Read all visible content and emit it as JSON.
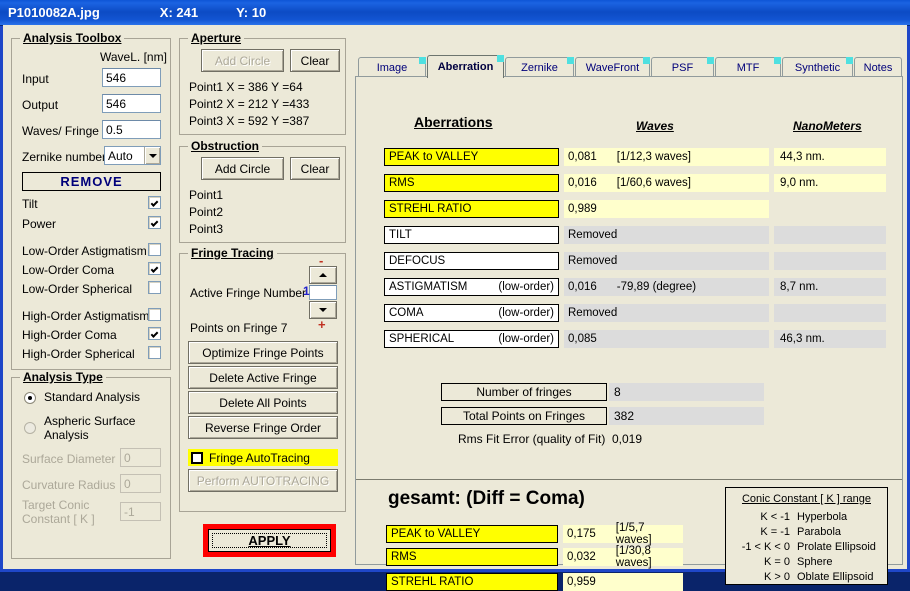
{
  "window": {
    "title": "P1010082A.jpg",
    "cursor_x_label": "X: 241",
    "cursor_y_label": "Y: 10"
  },
  "analysis_toolbox": {
    "legend": "Analysis Toolbox",
    "wavelength_header": "WaveL. [nm]",
    "input_label": "Input",
    "input_value": "546",
    "output_label": "Output",
    "output_value": "546",
    "waves_per_fringe_label": "Waves/ Fringe",
    "waves_per_fringe_value": "0.5",
    "zernike_number_label": "Zernike number",
    "zernike_number_value": "Auto",
    "remove_header": "REMOVE",
    "remove_items": [
      {
        "label": "Tilt",
        "checked": true
      },
      {
        "label": "Power",
        "checked": true
      },
      {
        "label": "Low-Order  Astigmatism",
        "checked": false
      },
      {
        "label": "Low-Order  Coma",
        "checked": true
      },
      {
        "label": "Low-Order  Spherical",
        "checked": false
      },
      {
        "label": "High-Order  Astigmatism",
        "checked": false
      },
      {
        "label": "High-Order  Coma",
        "checked": true
      },
      {
        "label": "High-Order  Spherical",
        "checked": false
      }
    ]
  },
  "analysis_type": {
    "legend": "Analysis Type",
    "standard_label": "Standard  Analysis",
    "standard_selected": true,
    "aspheric_label": "Aspheric  Surface Analysis",
    "aspheric_selected": false,
    "surface_diameter_label": "Surface Diameter",
    "surface_diameter_value": "0",
    "curvature_radius_label": "Curvature Radius",
    "curvature_radius_value": "0",
    "target_conic_label": "Target Conic Constant [ K ]",
    "target_conic_value": "-1"
  },
  "aperture": {
    "legend": "Aperture",
    "add_circle_label": "Add Circle",
    "clear_label": "Clear",
    "points": [
      "Point1  X =   386   Y =64",
      "Point2  X =   212   Y =433",
      "Point3  X =   592   Y =387"
    ]
  },
  "obstruction": {
    "legend": "Obstruction",
    "add_circle_label": "Add Circle",
    "clear_label": "Clear",
    "points": [
      "Point1",
      "Point2",
      "Point3"
    ]
  },
  "fringe_tracing": {
    "legend": "Fringe Tracing",
    "active_fringe_label": "Active Fringe Number",
    "active_fringe_value": "1",
    "spin_value": "",
    "minus_sign": "-",
    "plus_sign": "+",
    "points_on_fringe_label": "Points on  Fringe 7",
    "buttons": [
      "Optimize Fringe Points",
      "Delete Active Fringe",
      "Delete  All  Points",
      "Reverse  Fringe Order"
    ],
    "autotracing_label": "Fringe AutoTracing",
    "autotracing_checked": false,
    "perform_autotracing_label": "Perform  AUTOTRACING"
  },
  "apply_button": {
    "label": "APPLY"
  },
  "tabs": [
    {
      "label": "Image",
      "active": false
    },
    {
      "label": "Aberration",
      "active": true
    },
    {
      "label": "Zernike",
      "active": false
    },
    {
      "label": "WaveFront",
      "active": false
    },
    {
      "label": "PSF",
      "active": false
    },
    {
      "label": "MTF",
      "active": false
    },
    {
      "label": "Synthetic",
      "active": false
    },
    {
      "label": "Notes",
      "active": false
    }
  ],
  "aberrations": {
    "title": "Aberrations ",
    "col_waves": "Waves",
    "col_nanometers": "NanoMeters",
    "rows": [
      {
        "name": "PEAK to VALLEY",
        "sub": "",
        "highlight": true,
        "value": "0,081",
        "detail": "[1/12,3 waves]",
        "nm": "44,3  nm.",
        "removed": false
      },
      {
        "name": "RMS",
        "sub": "",
        "highlight": true,
        "value": "0,016",
        "detail": "[1/60,6 waves]",
        "nm": "9,0  nm.",
        "removed": false
      },
      {
        "name": "STREHL   RATIO",
        "sub": "",
        "highlight": true,
        "value": "0,989",
        "detail": "",
        "nm": "",
        "removed": false,
        "no_nm": true
      },
      {
        "name": "TILT",
        "sub": "",
        "highlight": false,
        "value": "Removed",
        "detail": "",
        "nm": "",
        "removed": true
      },
      {
        "name": "DEFOCUS",
        "sub": "",
        "highlight": false,
        "value": "Removed",
        "detail": "",
        "nm": "",
        "removed": true
      },
      {
        "name": "ASTIGMATISM",
        "sub": "(low-order)",
        "highlight": false,
        "value": "0,016",
        "detail": "-79,89  (degree)",
        "nm": "8,7  nm.",
        "removed": false,
        "gray": true
      },
      {
        "name": "COMA",
        "sub": "(low-order)",
        "highlight": false,
        "value": "Removed",
        "detail": "",
        "nm": "",
        "removed": true
      },
      {
        "name": "SPHERICAL",
        "sub": "(low-order)",
        "highlight": false,
        "value": "0,085",
        "detail": "",
        "nm": "46,3  nm.",
        "removed": false,
        "gray": true
      }
    ],
    "number_of_fringes_label": "Number of fringes",
    "number_of_fringes_value": "8",
    "total_points_label": "Total  Points on Fringes",
    "total_points_value": "382",
    "rms_fit_error_label": "Rms Fit Error (quality of Fit)",
    "rms_fit_error_value": "0,019"
  },
  "gesamt": {
    "title": "gesamt:  (Diff = Coma)",
    "rows": [
      {
        "name": "PEAK to VALLEY",
        "value": "0,175",
        "detail": "[1/5,7 waves]"
      },
      {
        "name": "RMS",
        "value": "0,032",
        "detail": "[1/30,8 waves]"
      },
      {
        "name": "STREHL   RATIO",
        "value": "0,959",
        "detail": ""
      }
    ]
  },
  "conic_constant": {
    "title": "Conic Constant [ K ]  range",
    "rows": [
      {
        "k": "K < -1",
        "name": "Hyperbola"
      },
      {
        "k": "K = -1",
        "name": "Parabola"
      },
      {
        "k": "-1 < K < 0",
        "name": "Prolate Ellipsoid"
      },
      {
        "k": "K =  0",
        "name": "Sphere"
      },
      {
        "k": "K > 0",
        "name": "Oblate Ellipsoid"
      }
    ]
  },
  "colors": {
    "highlight": "#ffff00",
    "value_bg": "#ffffcc",
    "disabled_bg": "#dcdcdc",
    "accent_red": "#ff0000",
    "face": "#ece9d8",
    "title_blue": "#0c4bc4"
  }
}
